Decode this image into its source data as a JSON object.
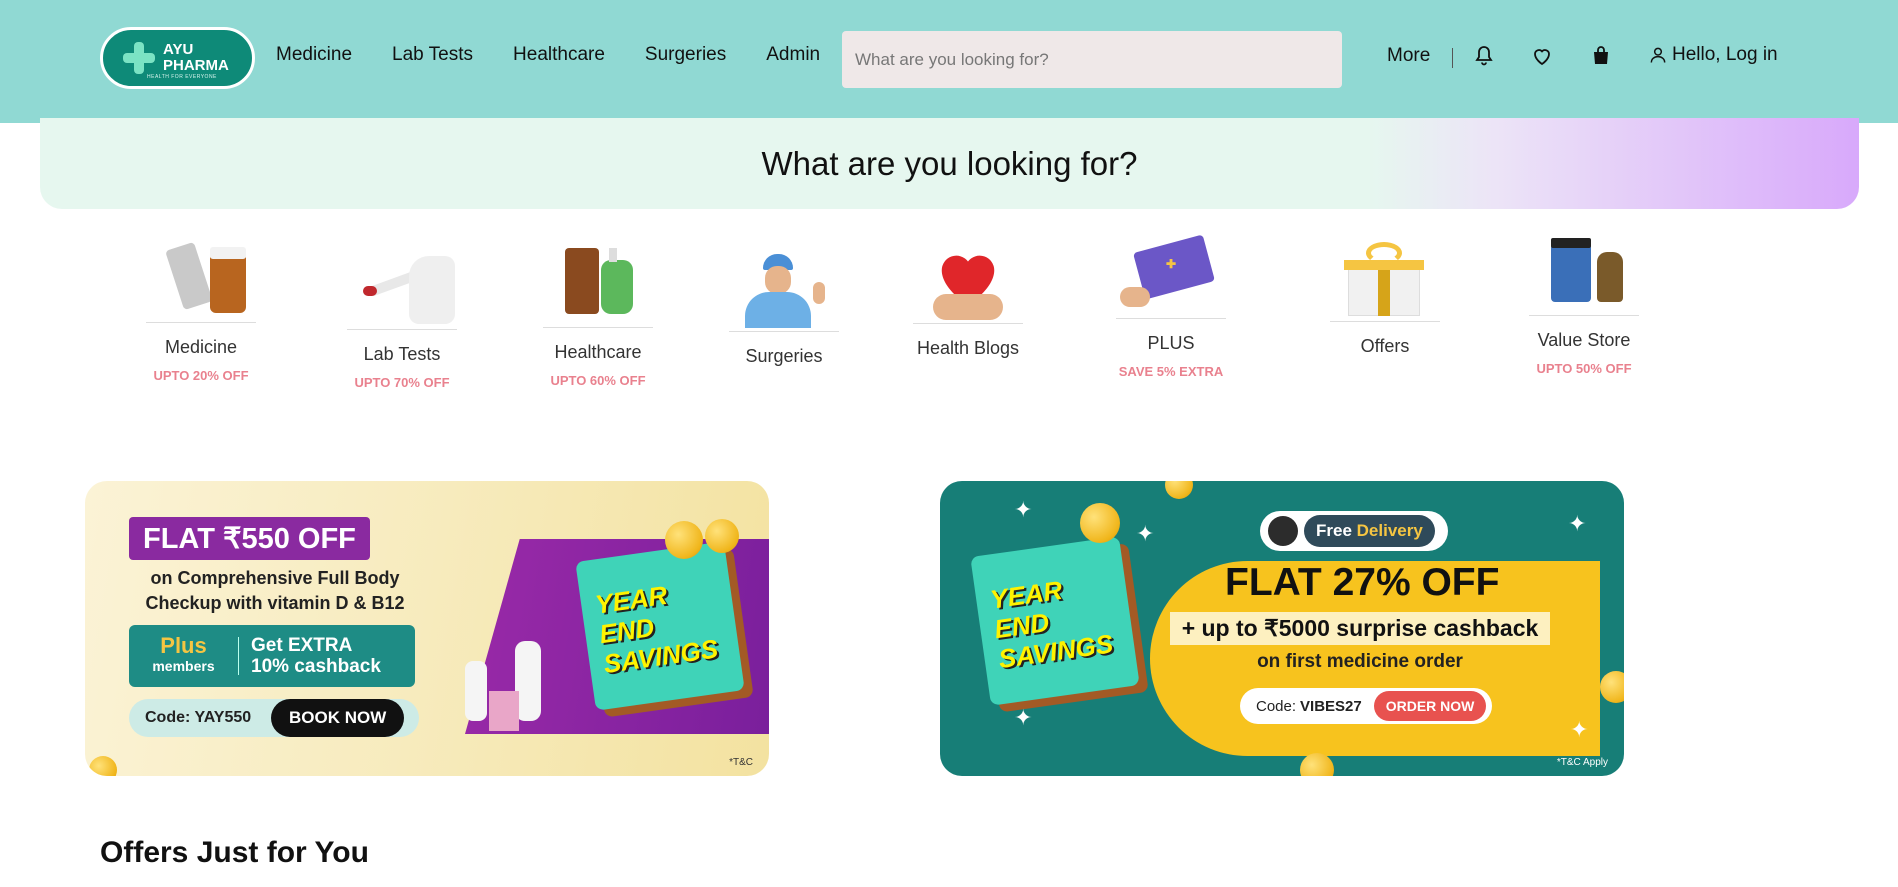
{
  "header": {
    "logo": {
      "line1": "AYU",
      "line2": "PHARMA",
      "tagline": "HEALTH FOR EVERYONE"
    },
    "nav": [
      "Medicine",
      "Lab Tests",
      "Healthcare",
      "Surgeries",
      "Admin"
    ],
    "search_placeholder": "What are you looking for?",
    "more_label": "More",
    "login_label": "Hello, Log in"
  },
  "banner": {
    "title": "What are you looking for?"
  },
  "categories": [
    {
      "label": "Medicine",
      "offer": "UPTO 20% OFF"
    },
    {
      "label": "Lab Tests",
      "offer": "UPTO 70% OFF"
    },
    {
      "label": "Healthcare",
      "offer": "UPTO 60% OFF"
    },
    {
      "label": "Surgeries",
      "offer": ""
    },
    {
      "label": "Health Blogs",
      "offer": ""
    },
    {
      "label": "PLUS",
      "offer": "SAVE 5% EXTRA"
    },
    {
      "label": "Offers",
      "offer": ""
    },
    {
      "label": "Value Store",
      "offer": "UPTO 50% OFF"
    }
  ],
  "promos": {
    "card1": {
      "flat": "FLAT ₹550 OFF",
      "desc_line1": "on Comprehensive Full Body",
      "desc_line2": "Checkup with vitamin D & B12",
      "plus_word": "Plus",
      "plus_members": "members",
      "extra_line1": "Get EXTRA",
      "extra_line2": "10% cashback",
      "code": "Code: YAY550",
      "cta": "BOOK NOW",
      "tc": "*T&C",
      "calendar": [
        "YEAR",
        "END",
        "SAVINGS"
      ]
    },
    "card2": {
      "pill_free": "Free",
      "pill_delivery": "Delivery",
      "flat": "FLAT 27% OFF",
      "cashback": "+ up to ₹5000 surprise cashback",
      "first_order": "on first medicine order",
      "code_prefix": "Code:",
      "code": "VIBES27",
      "cta": "ORDER NOW",
      "tc": "*T&C Apply",
      "calendar": [
        "YEAR",
        "END",
        "SAVINGS"
      ]
    }
  },
  "section": {
    "title": "Offers Just for You"
  },
  "colors": {
    "header_bg": "#90d9d3",
    "brand_green": "#0e8a78",
    "offer_pink": "#e9818e"
  }
}
